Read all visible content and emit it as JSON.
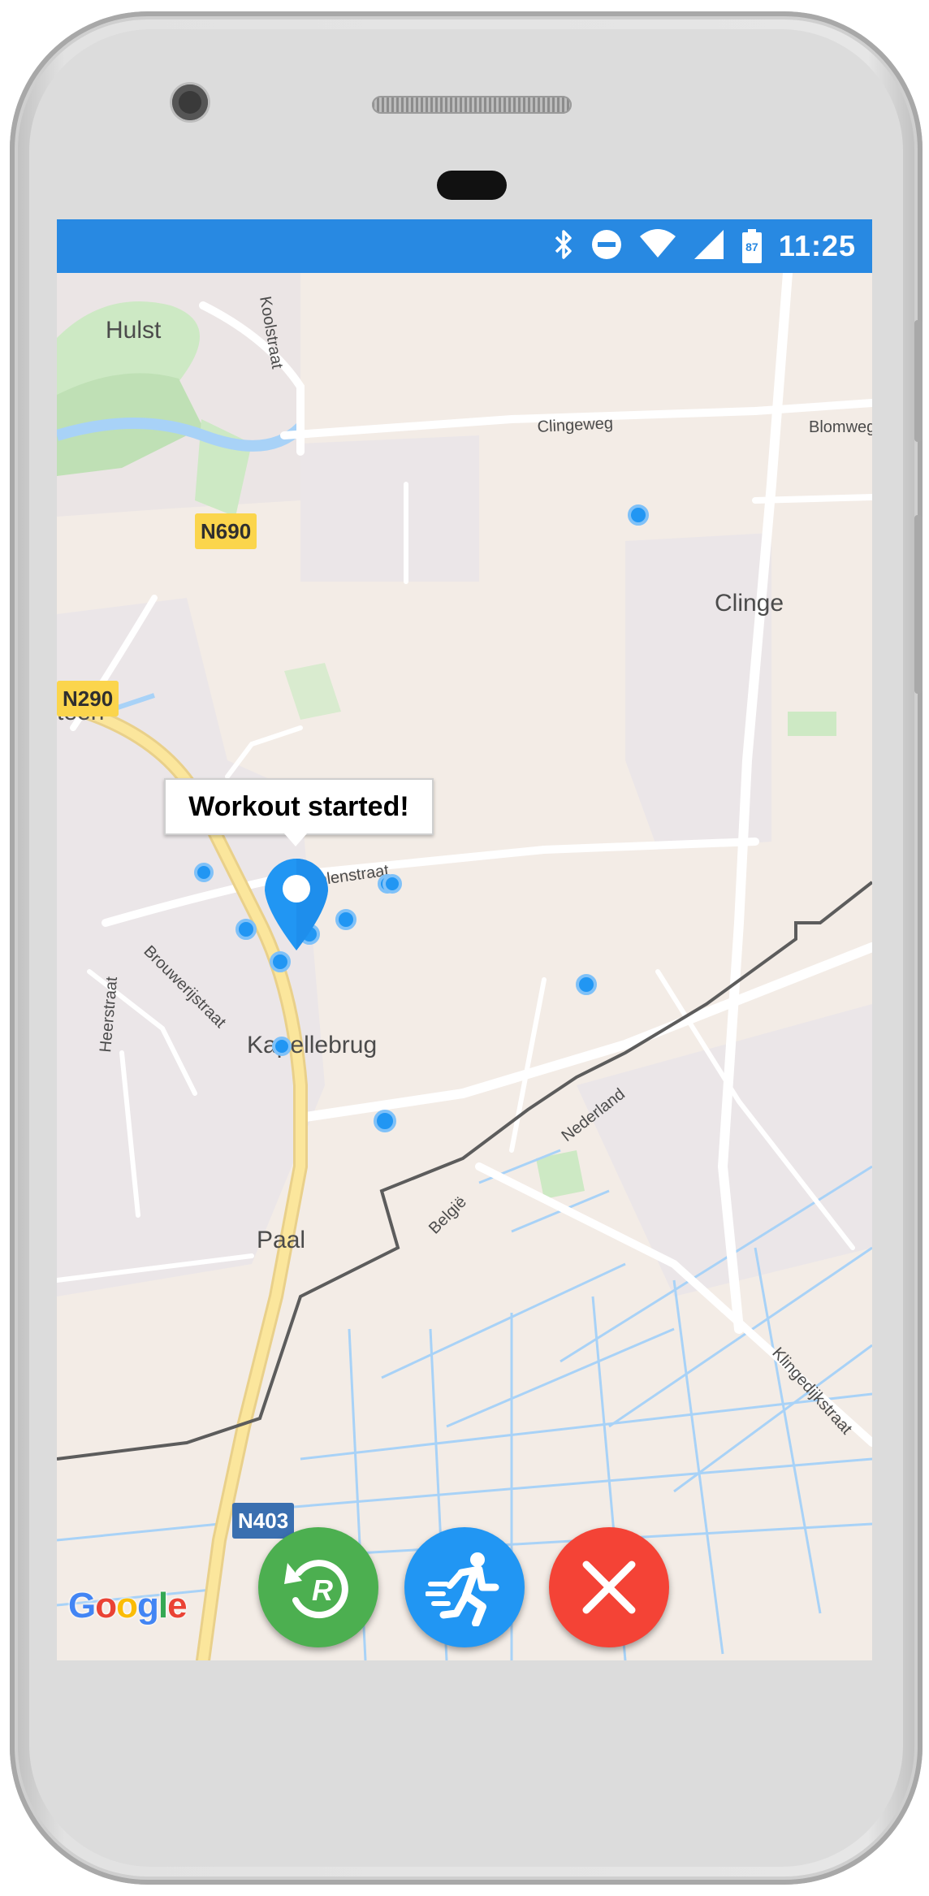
{
  "status_bar": {
    "time": "11:25",
    "battery_level": "87",
    "icons": [
      "bluetooth-icon",
      "do-not-disturb-icon",
      "wifi-icon",
      "signal-icon",
      "battery-icon"
    ],
    "color": "#2889e2"
  },
  "map": {
    "place_labels": {
      "hulst": "Hulst",
      "clinge": "Clinge",
      "kapellebrug": "Kapellebrug",
      "paal": "Paal",
      "teen": "teen"
    },
    "street_labels": {
      "koolstraat": "Koolstraat",
      "clingeweg": "Clingeweg",
      "blomweg": "Blomweg",
      "molenstraat": "Molenstraat",
      "brouwerijstraat": "Brouwerijstraat",
      "heerstraat": "Heerstraat",
      "nederland": "Nederland",
      "belgie": "België",
      "klingedijkstraat": "Klingedijkstraat"
    },
    "route_badges": {
      "n690": "N690",
      "n290": "N290",
      "n403": "N403"
    },
    "marker_tooltip": "Workout started!",
    "logo": "Google",
    "marker_color": "#2196f3"
  },
  "actions": {
    "reset_icon": "restart-icon",
    "run_icon": "running-person-icon",
    "cancel_icon": "close-icon",
    "colors": {
      "reset": "#4caf50",
      "run": "#2196f3",
      "cancel": "#f44336"
    }
  }
}
